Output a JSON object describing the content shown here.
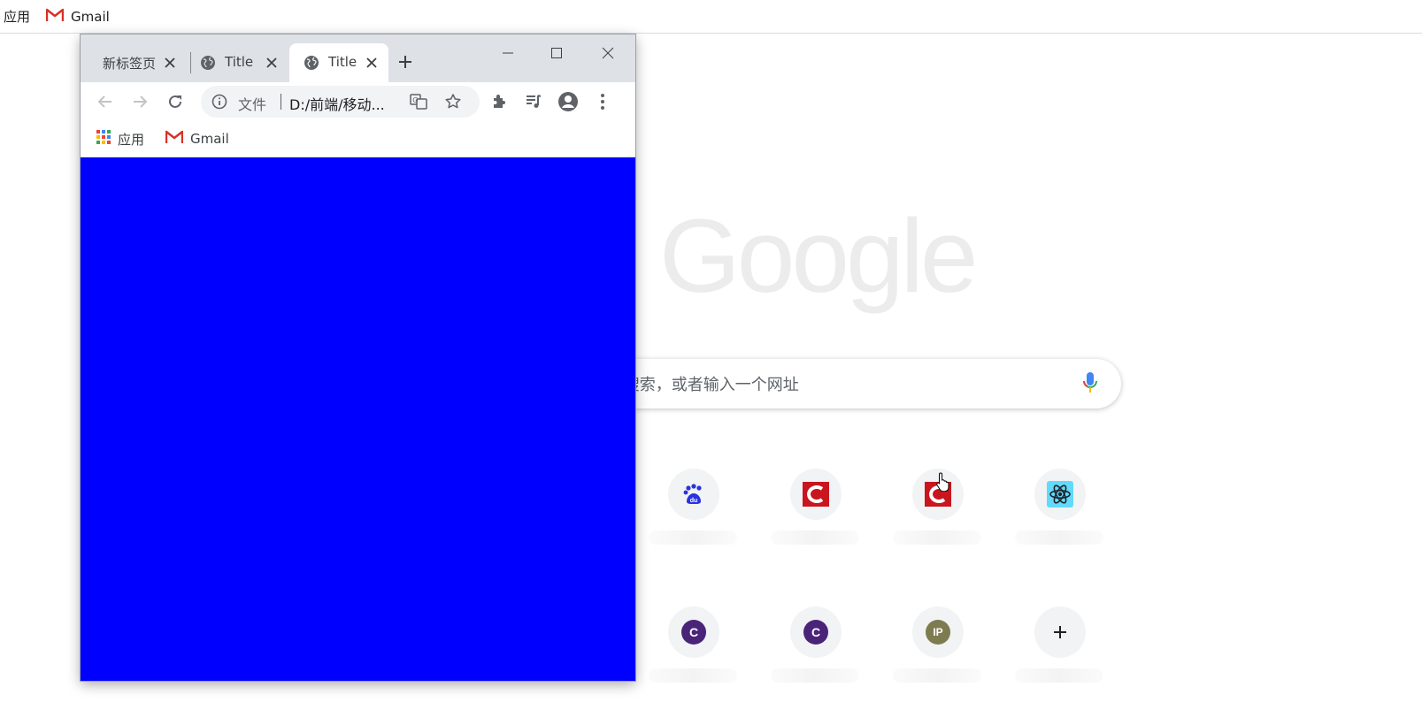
{
  "background_page": {
    "bookmarks": [
      {
        "label": "应用",
        "icon": "apps-text"
      },
      {
        "label": "Gmail",
        "icon": "gmail-icon"
      }
    ],
    "logo_text": "Google",
    "search": {
      "placeholder": "在 Google 上搜索，或者输入一个网址",
      "visible_placeholder": "e 上搜索，或者输入一个网址"
    },
    "shortcuts": [
      {
        "icon": "baidu-icon",
        "letter": "",
        "color": "#2932e1"
      },
      {
        "icon": "csdn-icon",
        "letter": "",
        "color": "#c9151e"
      },
      {
        "icon": "csdn-icon",
        "letter": "",
        "color": "#c9151e"
      },
      {
        "icon": "react-icon",
        "letter": "",
        "color": "#61dafb"
      },
      {
        "icon": "letter-icon",
        "letter": "C",
        "color": "#4a2478"
      },
      {
        "icon": "letter-icon",
        "letter": "C",
        "color": "#4a2478"
      },
      {
        "icon": "letter-icon",
        "letter": "IP",
        "color": "#7d7b50"
      },
      {
        "icon": "add-icon",
        "letter": "",
        "color": "#202124"
      }
    ]
  },
  "popup_window": {
    "tabs": [
      {
        "label": "新标签页",
        "active": false
      },
      {
        "label": "Title",
        "active": false
      },
      {
        "label": "Title",
        "active": true
      }
    ],
    "address": {
      "scheme_label": "文件",
      "url": "D:/前端/移动..."
    },
    "bookmarks": [
      {
        "label": "应用"
      },
      {
        "label": "Gmail"
      }
    ],
    "content_color": "#0000ff"
  }
}
